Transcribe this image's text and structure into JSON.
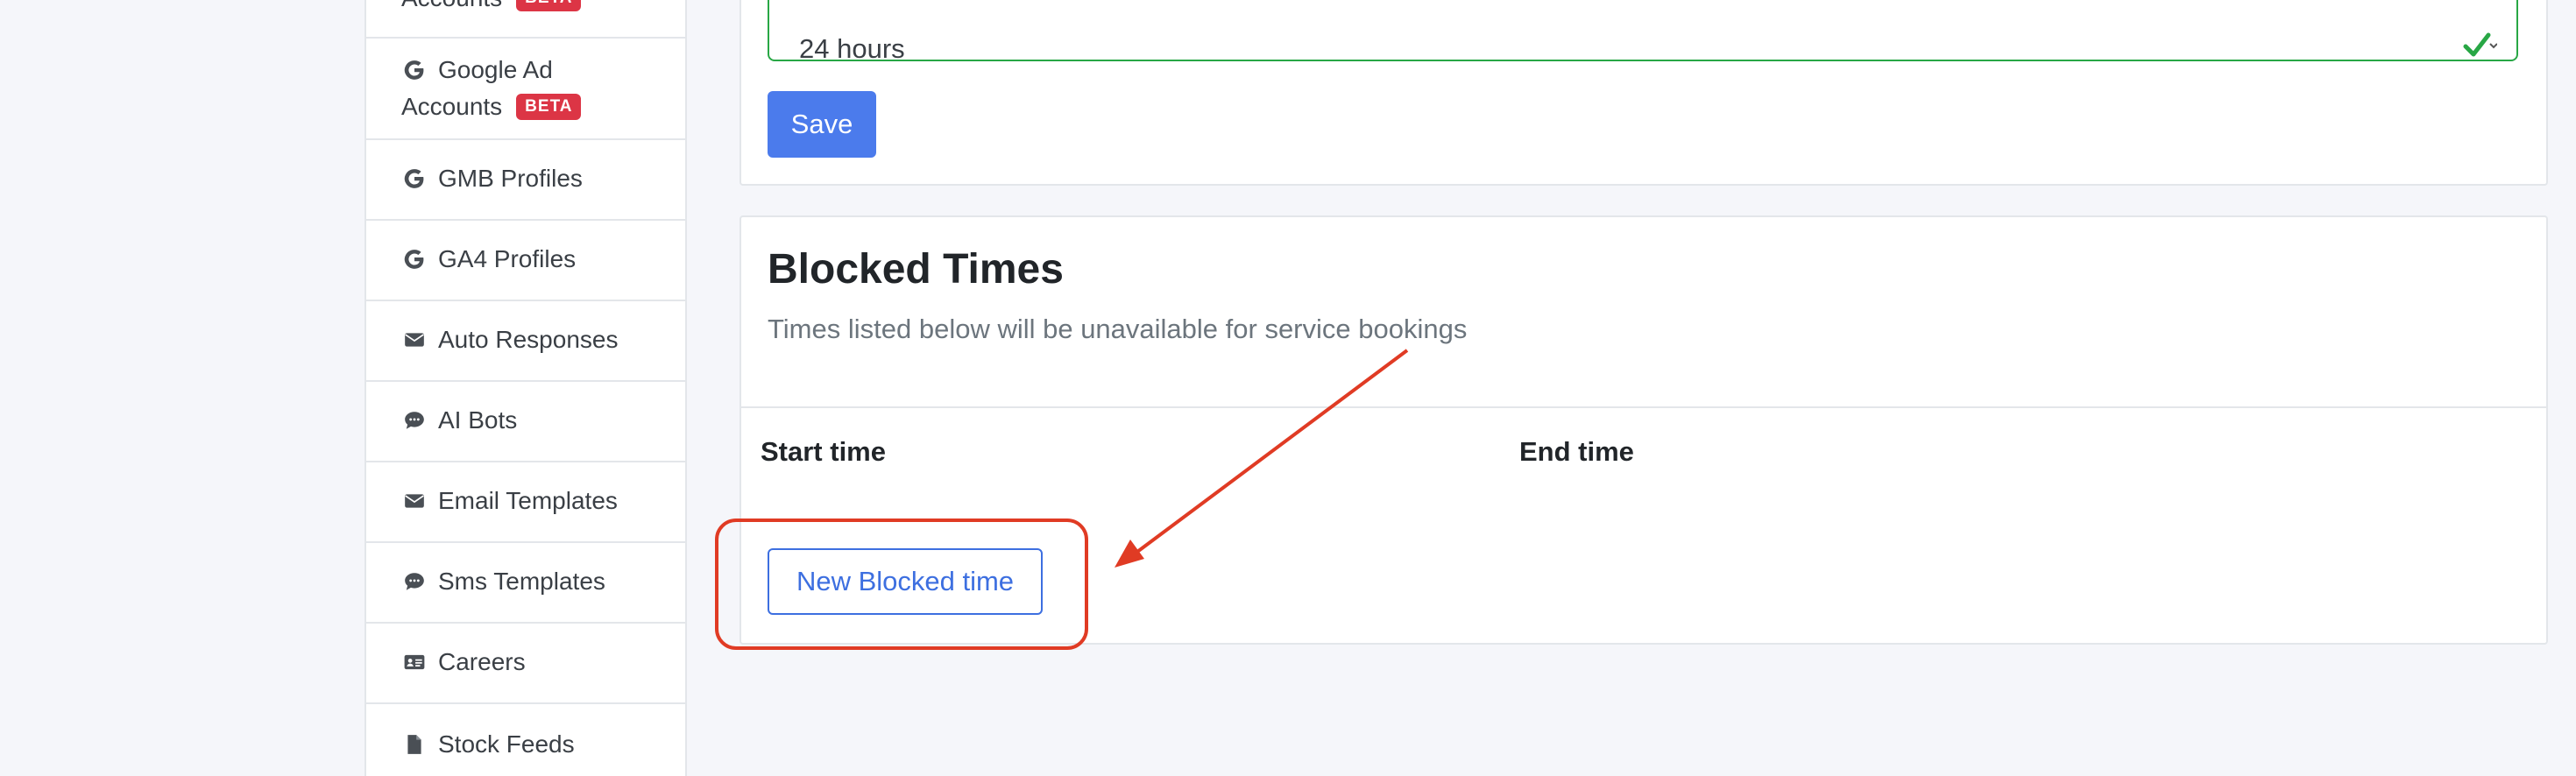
{
  "sidebar": {
    "items": [
      {
        "label": "Accounts",
        "badge": "BETA",
        "icon": "google-icon"
      },
      {
        "label_line1": "Google Ad",
        "label_line2": "Accounts",
        "badge": "BETA",
        "icon": "google-icon"
      },
      {
        "label": "GMB Profiles",
        "icon": "google-icon"
      },
      {
        "label": "GA4 Profiles",
        "icon": "google-icon"
      },
      {
        "label": "Auto Responses",
        "icon": "envelope-icon"
      },
      {
        "label": "AI Bots",
        "icon": "sms-bubble-icon"
      },
      {
        "label": "Email Templates",
        "icon": "envelope-icon"
      },
      {
        "label": "Sms Templates",
        "icon": "sms-bubble-icon"
      },
      {
        "label": "Careers",
        "icon": "id-card-icon"
      },
      {
        "label": "Stock Feeds",
        "icon": "file-icon"
      }
    ]
  },
  "settings": {
    "select_value": "24 hours",
    "save_label": "Save"
  },
  "blocked_times": {
    "title": "Blocked Times",
    "subtitle": "Times listed below will be unavailable for service bookings",
    "columns": [
      "Start time",
      "End time"
    ],
    "new_button": "New Blocked time"
  },
  "colors": {
    "primary": "#4b7bec",
    "success": "#28a745",
    "badge": "#dc3545",
    "annotation": "#e03b24"
  }
}
